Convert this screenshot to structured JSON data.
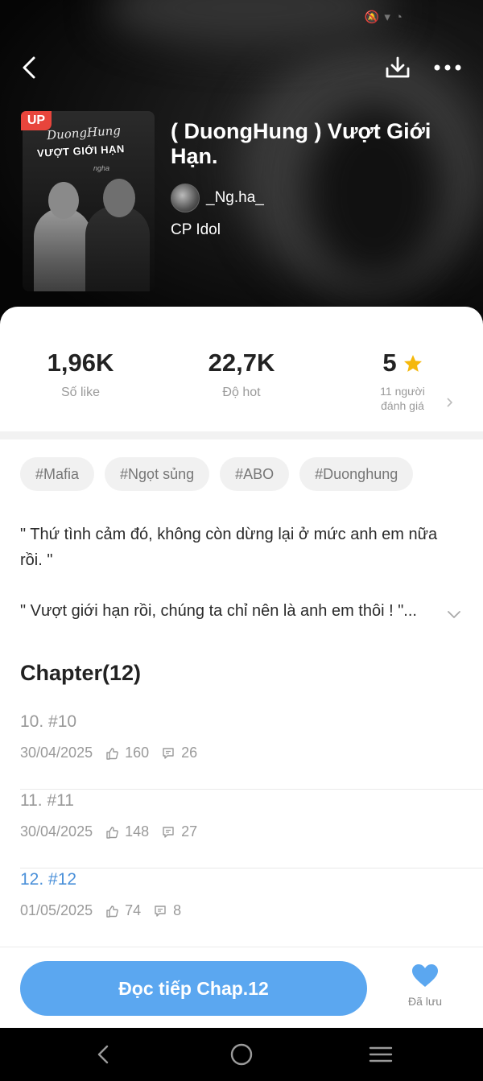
{
  "header": {
    "back_icon": "chevron-left-icon",
    "download_icon": "download-icon",
    "more_icon": "more-horizontal-icon"
  },
  "cover": {
    "badge": "UP",
    "script_text": "DuongHung",
    "title_text": "VƯỢT GIỚI HẠN",
    "signature": "ngha"
  },
  "story": {
    "title": "( DuongHung ) Vượt Giới Hạn.",
    "author": "_Ng.ha_",
    "category": "CP Idol"
  },
  "stats": {
    "likes_value": "1,96K",
    "likes_label": "Số like",
    "hot_value": "22,7K",
    "hot_label": "Độ hot",
    "rating_value": "5",
    "rating_label_line1": "11 người",
    "rating_label_line2": "đánh giá"
  },
  "tags": [
    "#Mafia",
    "#Ngọt sủng",
    "#ABO",
    "#Duonghung"
  ],
  "description": {
    "line1": "\" Thứ tình cảm đó, không còn dừng lại ở mức anh em nữa rồi. \"",
    "line2": "\" Vượt giới hạn rồi, chúng ta chỉ nên là anh em thôi ! \"..."
  },
  "chapters": {
    "heading": "Chapter(12)",
    "items": [
      {
        "title": "10. #10",
        "date": "30/04/2025",
        "likes": "160",
        "comments": "26",
        "current": false
      },
      {
        "title": "11. #11",
        "date": "30/04/2025",
        "likes": "148",
        "comments": "27",
        "current": false
      },
      {
        "title": "12. #12",
        "date": "01/05/2025",
        "likes": "74",
        "comments": "8",
        "current": true
      }
    ]
  },
  "bottom": {
    "read_label": "Đọc tiếp Chap.12",
    "save_label": "Đã lưu"
  },
  "colors": {
    "accent": "#5ba7f0",
    "current_chapter": "#4a90d9",
    "badge": "#e8453c",
    "star": "#f5b80b"
  }
}
